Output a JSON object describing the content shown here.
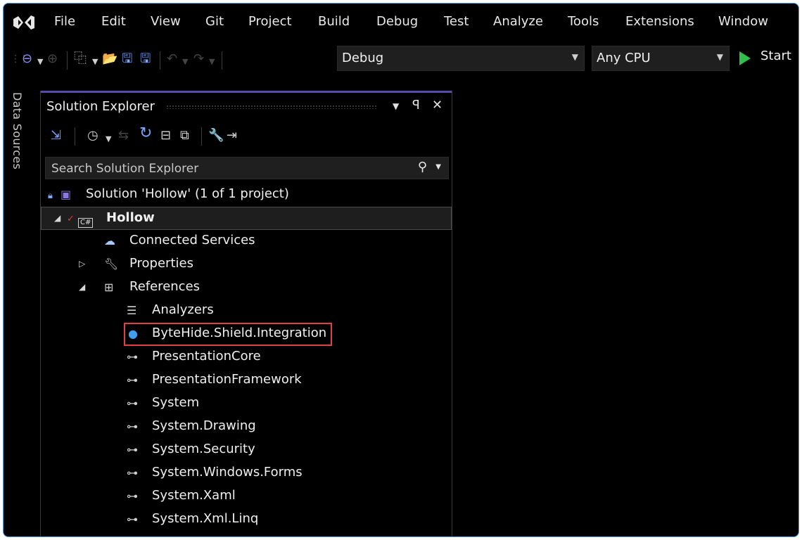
{
  "menu": {
    "items": [
      "File",
      "Edit",
      "View",
      "Git",
      "Project",
      "Build",
      "Debug",
      "Test",
      "Analyze",
      "Tools",
      "Extensions",
      "Window"
    ]
  },
  "toolbar": {
    "configuration": "Debug",
    "platform": "Any CPU",
    "start_label": "Start"
  },
  "side_strip": {
    "label": "Data Sources"
  },
  "solution_explorer": {
    "title": "Solution Explorer",
    "search_placeholder": "Search Solution Explorer",
    "tree": {
      "solution": "Solution 'Hollow' (1 of 1 project)",
      "project": "Hollow",
      "project_badge": "C#",
      "connected_services": "Connected Services",
      "properties": "Properties",
      "references": "References",
      "reference_items": [
        "Analyzers",
        "ByteHide.Shield.Integration",
        "PresentationCore",
        "PresentationFramework",
        "System",
        "System.Drawing",
        "System.Security",
        "System.Windows.Forms",
        "System.Xaml",
        "System.Xml.Linq"
      ]
    }
  },
  "colors": {
    "accent": "#5a4ab0",
    "start_green": "#2fbf4a",
    "highlight_red": "#e04040",
    "frame_border": "#4aa8d8"
  }
}
